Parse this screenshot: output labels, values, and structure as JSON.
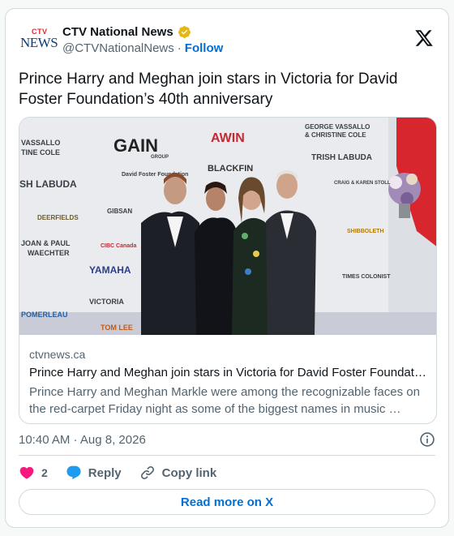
{
  "account": {
    "logo_text_top": "CTV",
    "logo_text_bottom": "NEWS",
    "name": "CTV National News",
    "handle": "@CTVNationalNews",
    "separator": "·",
    "follow_label": "Follow"
  },
  "tweet": {
    "text": "Prince Harry and Meghan join stars in Victoria for David Foster Foundation’s 40th anniversary",
    "timestamp": "10:40 AM · Aug 8, 2026"
  },
  "link_card": {
    "domain": "ctvnews.ca",
    "title": "Prince Harry and Meghan join stars in Victoria for David Foster Foundat…",
    "description": "Prince Harry and Meghan Markle were among the recognizable faces on the red-carpet Friday night as some of the biggest names in music …",
    "photo_backdrop_words": [
      "VASSALLO",
      "TINE COLE",
      "GAIN",
      "GROUP",
      "AWIN",
      "GEORGE VASSALLO",
      "& CHRISTINE COLE",
      "BLACKFIN",
      "TRISH LABUDA",
      "SH LABUDA",
      "David Foster Foundation",
      "DEERFIELDS",
      "GIBSAN",
      "JOAN & PAUL",
      "WAECHTER",
      "CIBC Canada",
      "YAMAHA",
      "VICTORIA",
      "POMERLEAU",
      "TOM LEE",
      "SHIBBOLETH",
      "TIMES COLONIST",
      "CRAIG & KAREN STOLL"
    ]
  },
  "actions": {
    "like_count": "2",
    "reply_label": "Reply",
    "copy_link_label": "Copy link",
    "read_more_label": "Read more on X"
  },
  "colors": {
    "accent": "#006fd6",
    "like": "#f91880",
    "reply": "#1d9bf0",
    "muted": "#536471",
    "border": "#cfd9de"
  },
  "icons": [
    "verified-badge-icon",
    "x-logo-icon",
    "info-icon",
    "heart-icon",
    "reply-bubble-icon",
    "link-icon"
  ]
}
